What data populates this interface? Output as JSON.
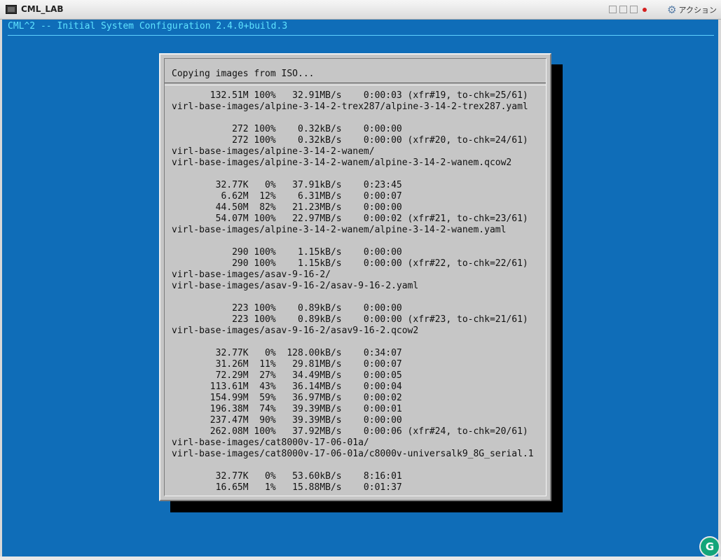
{
  "window": {
    "title": "CML_LAB",
    "action_label": "アクション"
  },
  "console": {
    "header": "CML^2 -- Initial System Configuration 2.4.0+build.3",
    "dialog_title": "Copying images from ISO...",
    "log_lines": [
      "       132.51M 100%   32.91MB/s    0:00:03 (xfr#19, to-chk=25/61)",
      "virl-base-images/alpine-3-14-2-trex287/alpine-3-14-2-trex287.yaml",
      "",
      "           272 100%    0.32kB/s    0:00:00",
      "           272 100%    0.32kB/s    0:00:00 (xfr#20, to-chk=24/61)",
      "virl-base-images/alpine-3-14-2-wanem/",
      "virl-base-images/alpine-3-14-2-wanem/alpine-3-14-2-wanem.qcow2",
      "",
      "        32.77K   0%   37.91kB/s    0:23:45",
      "         6.62M  12%    6.31MB/s    0:00:07",
      "        44.50M  82%   21.23MB/s    0:00:00",
      "        54.07M 100%   22.97MB/s    0:00:02 (xfr#21, to-chk=23/61)",
      "virl-base-images/alpine-3-14-2-wanem/alpine-3-14-2-wanem.yaml",
      "",
      "           290 100%    1.15kB/s    0:00:00",
      "           290 100%    1.15kB/s    0:00:00 (xfr#22, to-chk=22/61)",
      "virl-base-images/asav-9-16-2/",
      "virl-base-images/asav-9-16-2/asav-9-16-2.yaml",
      "",
      "           223 100%    0.89kB/s    0:00:00",
      "           223 100%    0.89kB/s    0:00:00 (xfr#23, to-chk=21/61)",
      "virl-base-images/asav-9-16-2/asav9-16-2.qcow2",
      "",
      "        32.77K   0%  128.00kB/s    0:34:07",
      "        31.26M  11%   29.81MB/s    0:00:07",
      "        72.29M  27%   34.49MB/s    0:00:05",
      "       113.61M  43%   36.14MB/s    0:00:04",
      "       154.99M  59%   36.97MB/s    0:00:02",
      "       196.38M  74%   39.39MB/s    0:00:01",
      "       237.47M  90%   39.39MB/s    0:00:00",
      "       262.08M 100%   37.92MB/s    0:00:06 (xfr#24, to-chk=20/61)",
      "virl-base-images/cat8000v-17-06-01a/",
      "virl-base-images/cat8000v-17-06-01a/c8000v-universalk9_8G_serial.1",
      "",
      "        32.77K   0%   53.60kB/s    8:16:01",
      "        16.65M   1%   15.88MB/s    0:01:37"
    ]
  },
  "colors": {
    "console_bg": "#0f6db8",
    "header_text": "#5fe3ff",
    "dialog_bg": "#c6c6c6",
    "shadow": "#000000"
  },
  "icons": {
    "app": "terminal-icon",
    "settings": "gear-icon",
    "record": "record-icon",
    "assistant": "grammarly-icon"
  }
}
